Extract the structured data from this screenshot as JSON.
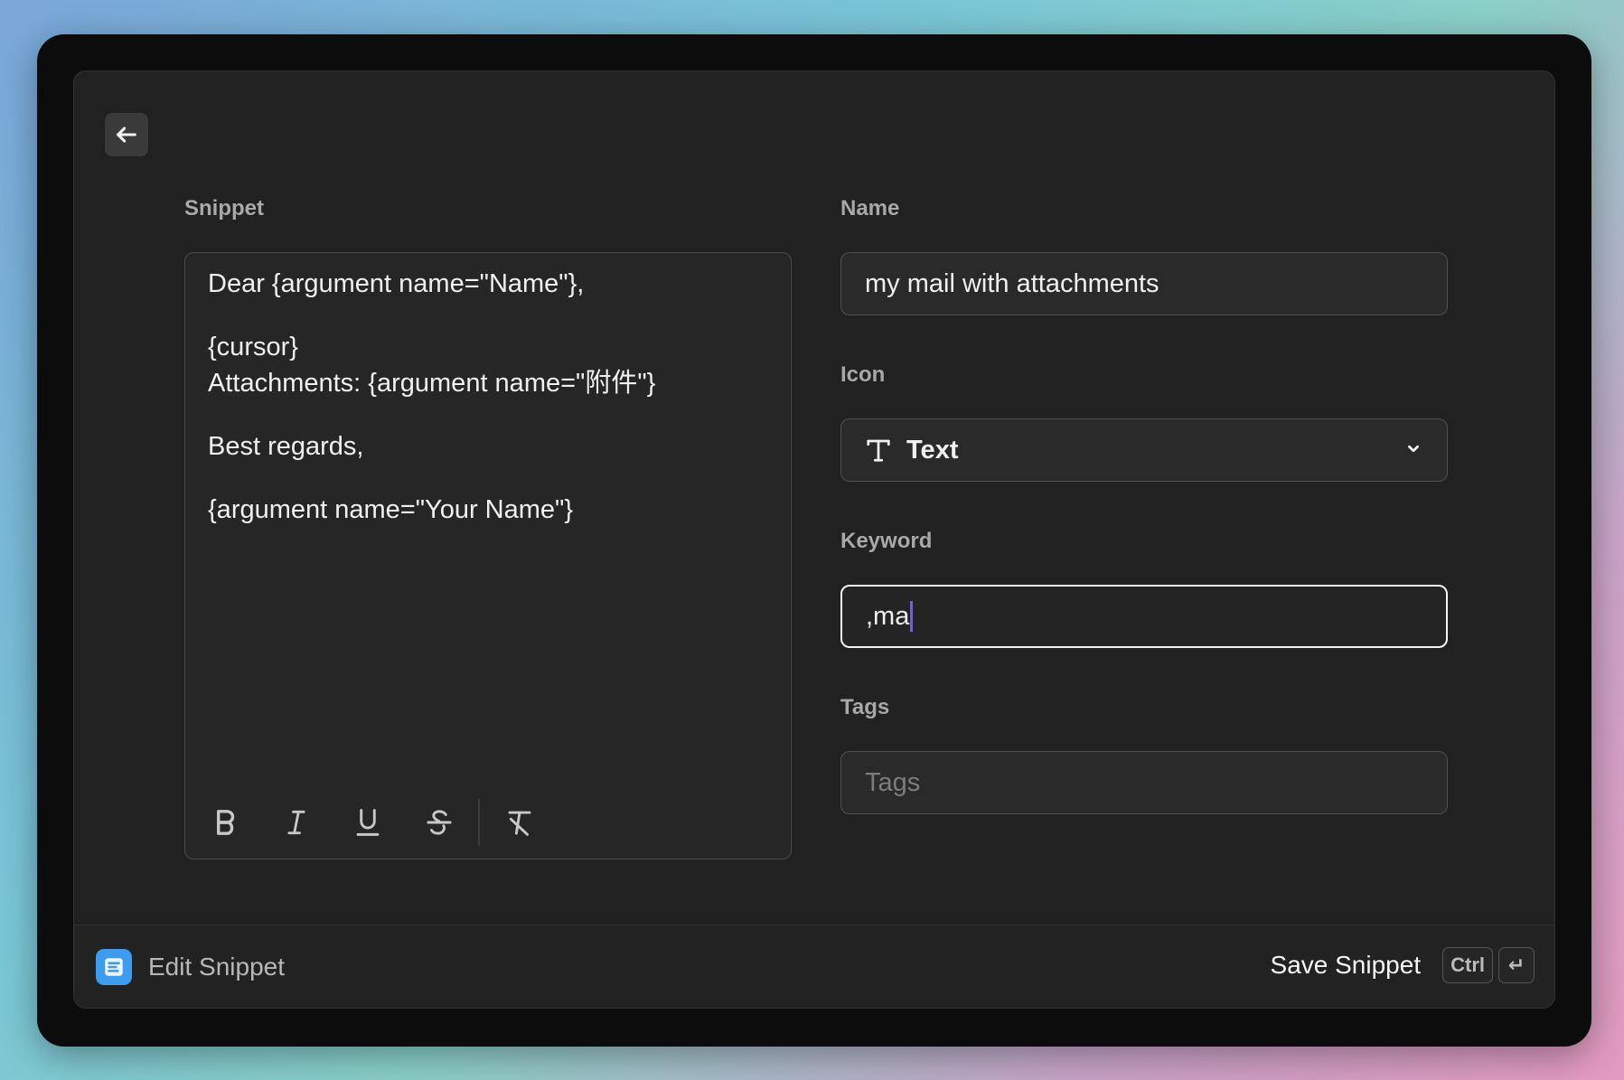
{
  "labels": {
    "snippet": "Snippet",
    "name": "Name",
    "icon": "Icon",
    "keyword": "Keyword",
    "tags": "Tags"
  },
  "snippet_lines": [
    "Dear {argument name=\"Name\"},",
    "{cursor}",
    "Attachments: {argument name=\"附件\"}",
    "Best regards,",
    "{argument name=\"Your Name\"}"
  ],
  "fields": {
    "name_value": "my mail with attachments",
    "icon_value": "Text",
    "keyword_value": ",ma",
    "tags_placeholder": "Tags"
  },
  "toolbar_icons": [
    "bold-icon",
    "italic-icon",
    "underline-icon",
    "strikethrough-icon",
    "clear-format-icon"
  ],
  "footer": {
    "title": "Edit Snippet",
    "save_label": "Save Snippet",
    "shortcut_ctrl": "Ctrl",
    "shortcut_enter": "↵"
  },
  "colors": {
    "accent_caret": "#6a5cff",
    "app_icon": "#3d9bf0"
  }
}
